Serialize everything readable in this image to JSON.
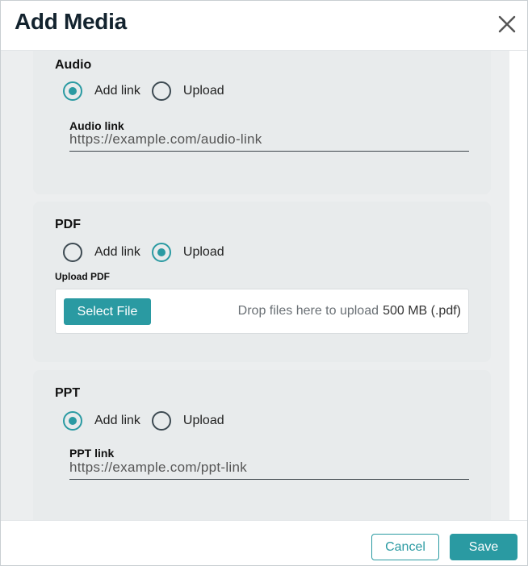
{
  "dialog": {
    "title": "Add Media",
    "close_icon": "close-icon"
  },
  "audio": {
    "section_label": "Audio",
    "radio_add_link": "Add link",
    "radio_upload": "Upload",
    "selected": "Add link",
    "field_label": "Audio link",
    "field_value": "https://example.com/audio-link"
  },
  "pdf": {
    "section_label": "PDF",
    "radio_add_link": "Add link",
    "radio_upload": "Upload",
    "selected": "Upload",
    "upload_label": "Upload PDF",
    "select_file_label": "Select File",
    "drop_text": "Drop files here to upload",
    "size_text": "500 MB (.pdf)"
  },
  "ppt": {
    "section_label": "PPT",
    "radio_add_link": "Add link",
    "radio_upload": "Upload",
    "selected": "Add link",
    "field_label": "PPT link",
    "field_value": "https://example.com/ppt-link"
  },
  "footer": {
    "cancel_label": "Cancel",
    "save_label": "Save"
  },
  "colors": {
    "accent": "#2a9aa2",
    "card_bg": "#e8ebec",
    "title": "#13232e"
  }
}
